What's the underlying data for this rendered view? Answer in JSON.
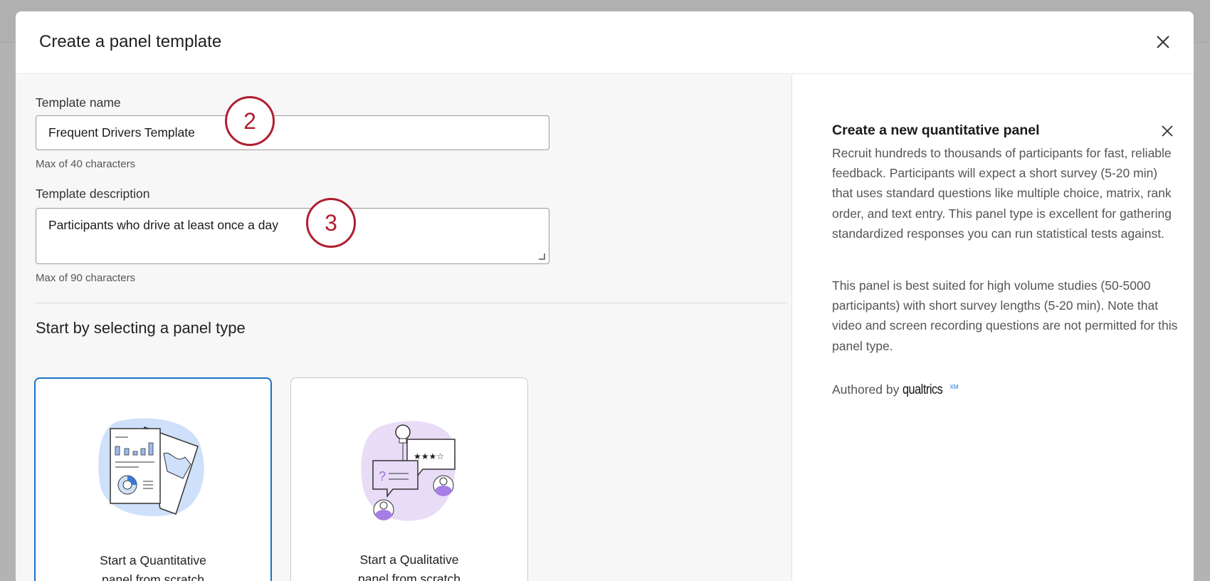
{
  "modal": {
    "title": "Create a panel template"
  },
  "form": {
    "name_label": "Template name",
    "name_value": "Frequent Drivers Template",
    "name_hint": "Max of 40 characters",
    "desc_label": "Template description",
    "desc_value": "Participants who drive at least once a day",
    "desc_hint": "Max of 90 characters"
  },
  "annotations": [
    "2",
    "3"
  ],
  "panel_types": {
    "heading": "Start by selecting a panel type",
    "cards": [
      {
        "line1": "Start a Quantitative",
        "line2": "panel from scratch",
        "selected": true
      },
      {
        "line1": "Start a Qualitative",
        "line2": "panel from scratch",
        "selected": false
      }
    ]
  },
  "info": {
    "title": "Create a new quantitative panel",
    "p1": "Recruit hundreds to thousands of participants for fast, reliable feedback. Participants will expect a short survey (5-20 min) that uses standard questions like multiple choice, matrix, rank order, and text entry. This panel type is excellent for gathering standardized responses you can run statistical tests against.",
    "p2": "This panel is best suited for high volume studies (50-5000 participants) with short survey lengths (5-20 min). Note that video and screen recording questions are not permitted for this panel type.",
    "authored_by": "Authored by",
    "brand": "qualtrics",
    "brand_sup": "XM"
  },
  "colors": {
    "accent": "#0b6ed1",
    "annotation": "#b01e2f",
    "selected_border": "#1a73c8"
  }
}
